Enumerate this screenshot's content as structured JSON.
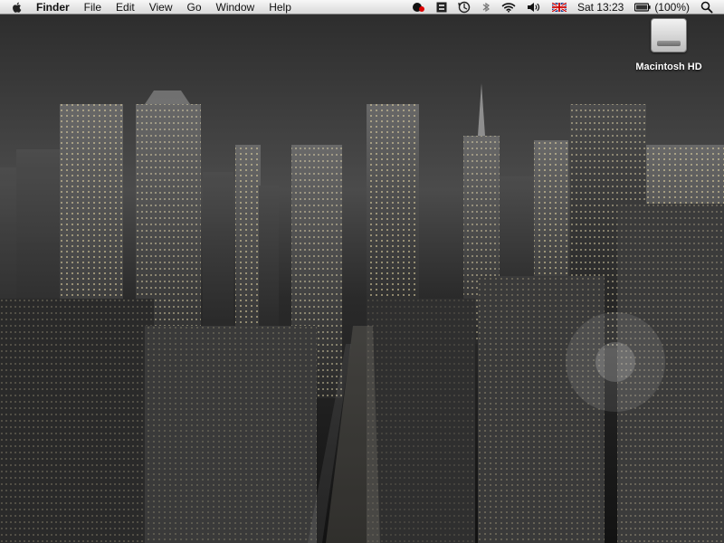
{
  "menubar": {
    "apple_icon": "apple-logo",
    "items": [
      "Finder",
      "File",
      "Edit",
      "View",
      "Go",
      "Window",
      "Help"
    ],
    "status": {
      "time": "Sat 13:23",
      "battery_label": "(100%)",
      "icons": [
        "status-app-icon",
        "status-grid-icon",
        "time-machine-icon",
        "bluetooth-icon",
        "wifi-icon",
        "volume-icon",
        "uk-flag-icon",
        "battery-icon",
        "spotlight-icon"
      ]
    }
  },
  "desktop": {
    "hd_label": "Macintosh HD"
  }
}
